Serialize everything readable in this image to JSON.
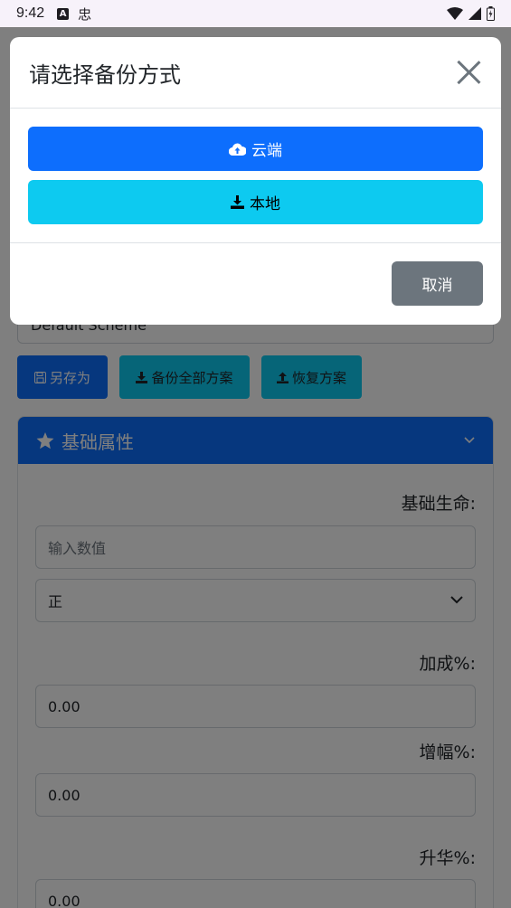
{
  "status_bar": {
    "time": "9:42",
    "icon_a": "A",
    "icon_b": "忠"
  },
  "page": {
    "scheme_select_value": "Default Scheme",
    "toolbar": {
      "save_as_label": "另存为",
      "backup_all_label": "备份全部方案",
      "restore_label": "恢复方案"
    },
    "card": {
      "title": "基础属性",
      "fields": {
        "base_life_label": "基础生命:",
        "base_life_placeholder": "输入数值",
        "sign_select_value": "正",
        "bonus_label": "加成%:",
        "bonus_value": "0.00",
        "amplify_label": "增幅%:",
        "amplify_value": "0.00",
        "sublimation_label": "升华%:",
        "sublimation_value": "0.00"
      }
    }
  },
  "modal": {
    "title": "请选择备份方式",
    "cloud_label": "云端",
    "local_label": "本地",
    "cancel_label": "取消"
  },
  "colors": {
    "primary": "#0d6efd",
    "info": "#0dcaf0",
    "secondary": "#6c757d",
    "backdrop": "rgba(0,0,0,0.5)"
  }
}
